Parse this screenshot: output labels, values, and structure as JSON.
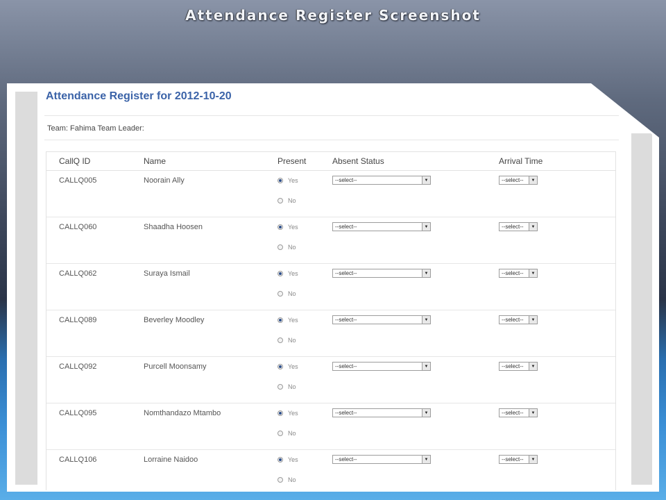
{
  "slide": {
    "title": "Attendance Register Screenshot"
  },
  "page": {
    "title": "Attendance Register for 2012-10-20",
    "team_line": "Team: Fahima Team Leader:"
  },
  "table": {
    "headers": {
      "id": "CallQ ID",
      "name": "Name",
      "present": "Present",
      "absent": "Absent Status",
      "arrival": "Arrival Time"
    },
    "yes_label": "Yes",
    "no_label": "No",
    "select_placeholder": "--select--",
    "rows": [
      {
        "id": "CALLQ005",
        "name": "Noorain Ally",
        "present": "Yes"
      },
      {
        "id": "CALLQ060",
        "name": "Shaadha Hoosen",
        "present": "Yes"
      },
      {
        "id": "CALLQ062",
        "name": "Suraya Ismail",
        "present": "Yes"
      },
      {
        "id": "CALLQ089",
        "name": "Beverley Moodley",
        "present": "Yes"
      },
      {
        "id": "CALLQ092",
        "name": "Purcell Moonsamy",
        "present": "Yes"
      },
      {
        "id": "CALLQ095",
        "name": "Nomthandazo Mtambo",
        "present": "Yes"
      },
      {
        "id": "CALLQ106",
        "name": "Lorraine Naidoo",
        "present": "Yes"
      }
    ]
  }
}
